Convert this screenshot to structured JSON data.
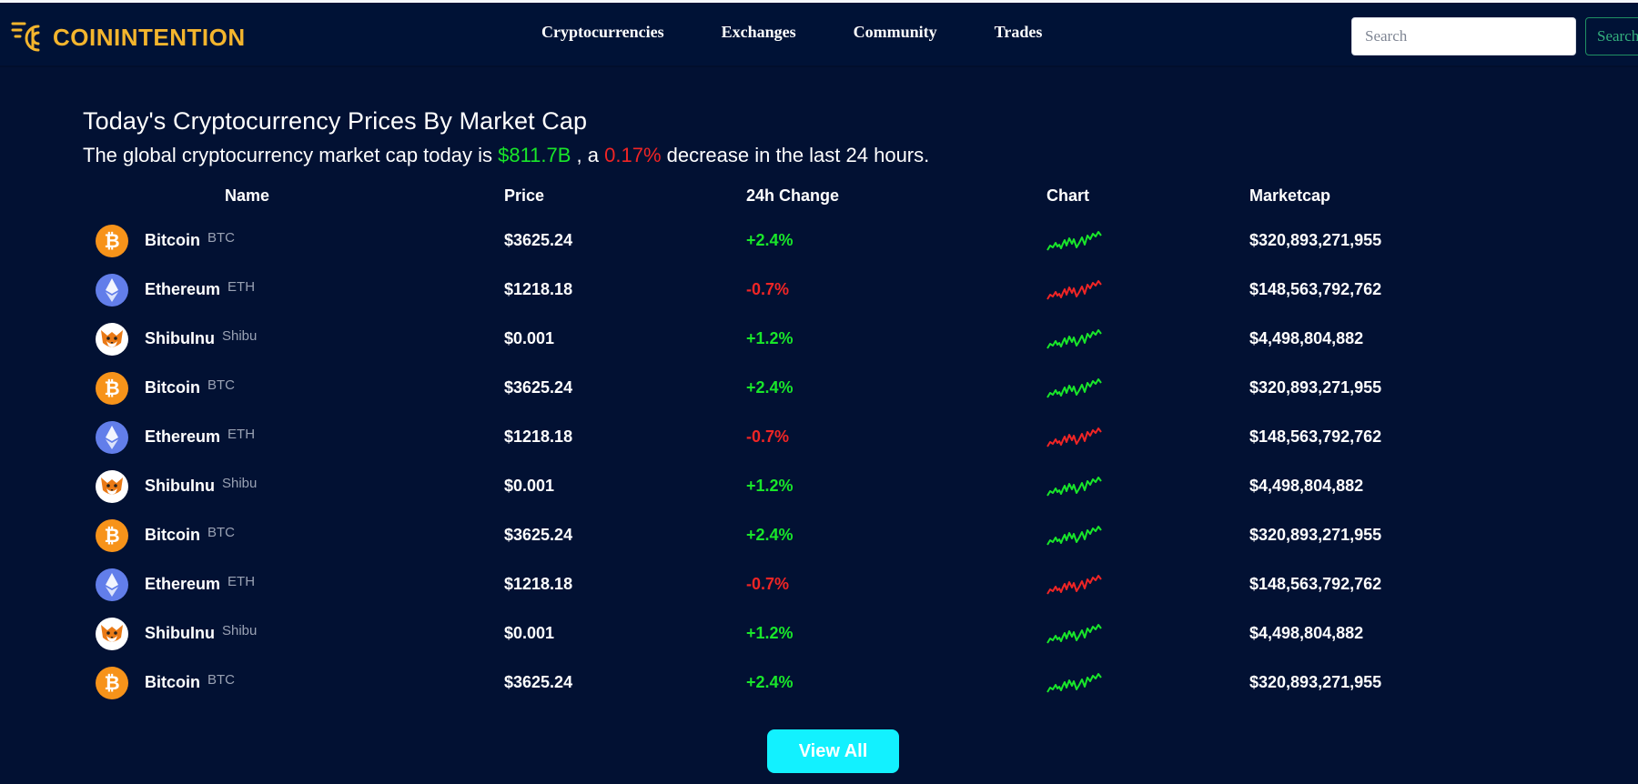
{
  "brand": {
    "logo_text": "COININTENTION",
    "logo_color": "#f4b52d"
  },
  "nav": {
    "links": [
      "Cryptocurrencies",
      "Exchanges",
      "Community",
      "Trades"
    ]
  },
  "search": {
    "placeholder": "Search",
    "value": "",
    "button_label": "Search"
  },
  "heading": "Today's Cryptocurrency Prices By Market Cap",
  "subheading": {
    "prefix": "The global cryptocurrency market cap today is ",
    "market_cap": "$811.7B",
    "middle": " , a ",
    "change": "0.17%",
    "suffix": " decrease in the last 24 hours."
  },
  "table": {
    "columns": {
      "name": "Name",
      "price": "Price",
      "change": "24h Change",
      "chart": "Chart",
      "marketcap": "Marketcap"
    },
    "rows": [
      {
        "name": "Bitcoin",
        "symbol": "BTC",
        "price": "$3625.24",
        "change": "+2.4%",
        "trend": "up",
        "marketcap": "$320,893,271,955",
        "icon": "bitcoin-icon"
      },
      {
        "name": "Ethereum",
        "symbol": "ETH",
        "price": "$1218.18",
        "change": "-0.7%",
        "trend": "down",
        "marketcap": "$148,563,792,762",
        "icon": "ethereum-icon"
      },
      {
        "name": "ShibuInu",
        "symbol": "Shibu",
        "price": "$0.001",
        "change": "+1.2%",
        "trend": "up",
        "marketcap": "$4,498,804,882",
        "icon": "shiba-icon"
      },
      {
        "name": "Bitcoin",
        "symbol": "BTC",
        "price": "$3625.24",
        "change": "+2.4%",
        "trend": "up",
        "marketcap": "$320,893,271,955",
        "icon": "bitcoin-icon"
      },
      {
        "name": "Ethereum",
        "symbol": "ETH",
        "price": "$1218.18",
        "change": "-0.7%",
        "trend": "down",
        "marketcap": "$148,563,792,762",
        "icon": "ethereum-icon"
      },
      {
        "name": "ShibuInu",
        "symbol": "Shibu",
        "price": "$0.001",
        "change": "+1.2%",
        "trend": "up",
        "marketcap": "$4,498,804,882",
        "icon": "shiba-icon"
      },
      {
        "name": "Bitcoin",
        "symbol": "BTC",
        "price": "$3625.24",
        "change": "+2.4%",
        "trend": "up",
        "marketcap": "$320,893,271,955",
        "icon": "bitcoin-icon"
      },
      {
        "name": "Ethereum",
        "symbol": "ETH",
        "price": "$1218.18",
        "change": "-0.7%",
        "trend": "down",
        "marketcap": "$148,563,792,762",
        "icon": "ethereum-icon"
      },
      {
        "name": "ShibuInu",
        "symbol": "Shibu",
        "price": "$0.001",
        "change": "+1.2%",
        "trend": "up",
        "marketcap": "$4,498,804,882",
        "icon": "shiba-icon"
      },
      {
        "name": "Bitcoin",
        "symbol": "BTC",
        "price": "$3625.24",
        "change": "+2.4%",
        "trend": "up",
        "marketcap": "$320,893,271,955",
        "icon": "bitcoin-icon"
      }
    ]
  },
  "view_all_label": "View All",
  "colors": {
    "background": "#021133",
    "header": "#001236",
    "positive": "#19e62a",
    "negative": "#f02525",
    "cta": "#12f1ff",
    "bitcoin": "#f7931a",
    "ethereum": "#627eea",
    "shiba": "#e84142"
  }
}
